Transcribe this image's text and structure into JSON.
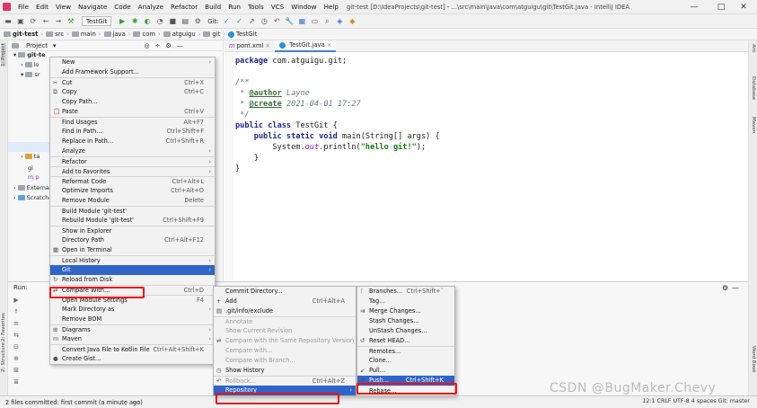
{
  "app": {
    "menu": [
      "File",
      "Edit",
      "View",
      "Navigate",
      "Code",
      "Analyze",
      "Refactor",
      "Build",
      "Run",
      "Tools",
      "VCS",
      "Window",
      "Help"
    ],
    "title": "git-test [D:\\IdeaProjects\\git-test] - ...\\src\\main\\java\\com\\atguigu\\git\\TestGit.java - IntelliJ IDEA",
    "window_controls": {
      "minimize": "—",
      "maximize": "□",
      "close": "✕"
    }
  },
  "toolbar": {
    "run_config": "TestGit",
    "git_label": "Git:"
  },
  "breadcrumb": [
    "git-test",
    "src",
    "main",
    "java",
    "com",
    "atguigu",
    "git",
    "TestGit"
  ],
  "left_stripe": {
    "project": "1: Project",
    "favorites": "2: Favorites",
    "structure": "Z: Structure"
  },
  "right_stripe": {
    "ant": "Ant",
    "database": "Database",
    "maven": "Maven",
    "wordbook": "Word Book"
  },
  "project_panel": {
    "title": "Project",
    "tree": [
      "git-te",
      "lo",
      "sr",
      "ta",
      "gi",
      "p",
      "External Libraries",
      "Scratches and Consoles"
    ]
  },
  "editor": {
    "tabs": [
      "pom.xml",
      "TestGit.java"
    ],
    "code": {
      "package_kw": "package",
      "package_name": " com.atguigu.git;",
      "doc_open": "/**",
      "author_tag": "@author",
      "author_val": " Layne",
      "create_tag": "@create",
      "create_val": " 2021-04-01 17:27",
      "doc_close": " */",
      "class_kw": "public class",
      "class_name": " TestGit {",
      "method_kw": "public static void",
      "method_sig": " main(String[] args) {",
      "print_pre": "System.",
      "print_out": "out",
      "print_post": ".println(",
      "print_str": "\"hello git!\"",
      "print_end": ");",
      "close1": "}",
      "close2": "}"
    }
  },
  "bottom": {
    "run_label": "Run:",
    "side_icons": [
      "▶",
      "↑",
      "≡",
      "⇆",
      "⊟",
      "⊕",
      "⊠",
      "≣"
    ]
  },
  "status": {
    "left": "2 files committed: first commit (a minute ago)",
    "right": "12:1  CRLF  UTF-8  4 spaces  Git: master"
  },
  "watermark": "CSDN @BugMaker.Chevy",
  "context_menu": [
    {
      "label": "New",
      "arrow": "›"
    },
    {
      "label": "Add Framework Support..."
    },
    {
      "label": "Cut",
      "sc": "Ctrl+X",
      "icon": "✂",
      "sep": true
    },
    {
      "label": "Copy",
      "sc": "Ctrl+C",
      "icon": "⧉"
    },
    {
      "label": "Copy Path..."
    },
    {
      "label": "Paste",
      "sc": "Ctrl+V",
      "icon": "📋"
    },
    {
      "label": "Find Usages",
      "sc": "Alt+F7",
      "sep": true
    },
    {
      "label": "Find in Path...",
      "sc": "Ctrl+Shift+F"
    },
    {
      "label": "Replace in Path...",
      "sc": "Ctrl+Shift+R"
    },
    {
      "label": "Analyze",
      "arrow": "›"
    },
    {
      "label": "Refactor",
      "arrow": "›",
      "sep": true
    },
    {
      "label": "Add to Favorites",
      "arrow": "›",
      "sep": true
    },
    {
      "label": "Reformat Code",
      "sc": "Ctrl+Alt+L",
      "sep": true
    },
    {
      "label": "Optimize Imports",
      "sc": "Ctrl+Alt+O"
    },
    {
      "label": "Remove Module",
      "sc": "Delete"
    },
    {
      "label": "Build Module 'git-test'",
      "sep": true
    },
    {
      "label": "Rebuild Module 'git-test'",
      "sc": "Ctrl+Shift+F9"
    },
    {
      "label": "Show in Explorer",
      "sep": true
    },
    {
      "label": "Directory Path",
      "sc": "Ctrl+Alt+F12"
    },
    {
      "label": "Open in Terminal",
      "icon": "▦"
    },
    {
      "label": "Local History",
      "arrow": "›",
      "sep": true
    },
    {
      "label": "Git",
      "arrow": "›",
      "hl": true
    },
    {
      "label": "Reload from Disk",
      "icon": "↻"
    },
    {
      "label": "Compare With...",
      "sc": "Ctrl+D",
      "icon": "⇄",
      "sep": true
    },
    {
      "label": "Open Module Settings",
      "sc": "F4",
      "sep": true
    },
    {
      "label": "Mark Directory as",
      "arrow": "›"
    },
    {
      "label": "Remove BOM"
    },
    {
      "label": "Diagrams",
      "arrow": "›",
      "icon": "⊞",
      "sep": true
    },
    {
      "label": "Maven",
      "arrow": "›",
      "icon": "m"
    },
    {
      "label": "Convert Java File to Kotlin File",
      "sc": "Ctrl+Alt+Shift+K",
      "sep": true
    },
    {
      "label": "Create Gist...",
      "icon": "●"
    }
  ],
  "git_submenu": [
    {
      "label": "Commit Directory..."
    },
    {
      "label": "Add",
      "sc": "Ctrl+Alt+A",
      "icon": "+"
    },
    {
      "label": ".git/info/exclude",
      "icon": "▤"
    },
    {
      "label": "Annotate",
      "disabled": true,
      "sep": true
    },
    {
      "label": "Show Current Revision",
      "disabled": true
    },
    {
      "label": "Compare with the Same Repository Version",
      "disabled": true,
      "icon": "⇄"
    },
    {
      "label": "Compare with...",
      "disabled": true
    },
    {
      "label": "Compare with Branch...",
      "disabled": true
    },
    {
      "label": "Show History",
      "icon": "◷"
    },
    {
      "label": "Rollback...",
      "sc": "Ctrl+Alt+Z",
      "disabled": true,
      "icon": "↶",
      "sep": true
    },
    {
      "label": "Repository",
      "arrow": "›",
      "hl": true
    }
  ],
  "repo_submenu": [
    {
      "label": "Branches...",
      "sc": "Ctrl+Shift+`",
      "icon": "ᚴ"
    },
    {
      "label": "Tag..."
    },
    {
      "label": "Merge Changes...",
      "icon": "⇉"
    },
    {
      "label": "Stash Changes..."
    },
    {
      "label": "UnStash Changes..."
    },
    {
      "label": "Reset HEAD...",
      "icon": "↺"
    },
    {
      "label": "Remotes...",
      "sep": true
    },
    {
      "label": "Clone..."
    },
    {
      "label": "Pull...",
      "icon": "↙"
    },
    {
      "label": "Push...",
      "sc": "Ctrl+Shift+K",
      "icon": "↗",
      "hl": true
    },
    {
      "label": "Rebase...",
      "sep": true
    }
  ]
}
